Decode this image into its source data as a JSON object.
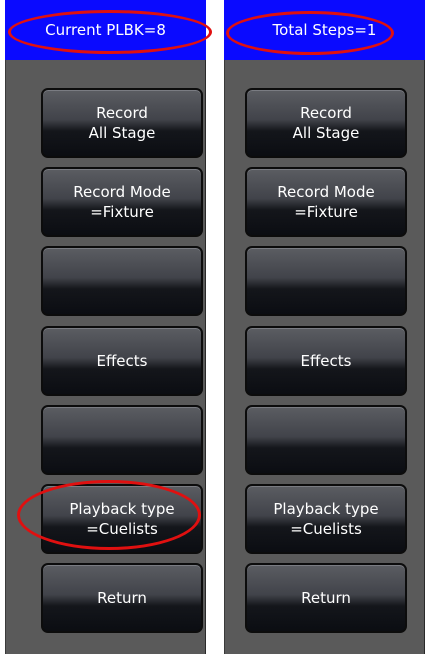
{
  "panels": [
    {
      "header": "Current PLBK=8",
      "buttons": [
        {
          "line1": "Record",
          "line2": "All Stage"
        },
        {
          "line1": "Record Mode",
          "line2": "=Fixture"
        },
        {
          "line1": "",
          "line2": ""
        },
        {
          "line1": "Effects",
          "line2": ""
        },
        {
          "line1": "",
          "line2": ""
        },
        {
          "line1": "Playback type",
          "line2": "=Cuelists"
        },
        {
          "line1": "Return",
          "line2": ""
        }
      ]
    },
    {
      "header": "Total Steps=1",
      "buttons": [
        {
          "line1": "Record",
          "line2": "All Stage"
        },
        {
          "line1": "Record Mode",
          "line2": "=Fixture"
        },
        {
          "line1": "",
          "line2": ""
        },
        {
          "line1": "Effects",
          "line2": ""
        },
        {
          "line1": "",
          "line2": ""
        },
        {
          "line1": "Playback type",
          "line2": "=Cuelists"
        },
        {
          "line1": "Return",
          "line2": ""
        }
      ]
    }
  ],
  "colors": {
    "header_bg": "#0a0aff",
    "panel_bg": "#5a5a5a",
    "highlight_oval": "#e01010",
    "button_text": "#ffffff"
  }
}
